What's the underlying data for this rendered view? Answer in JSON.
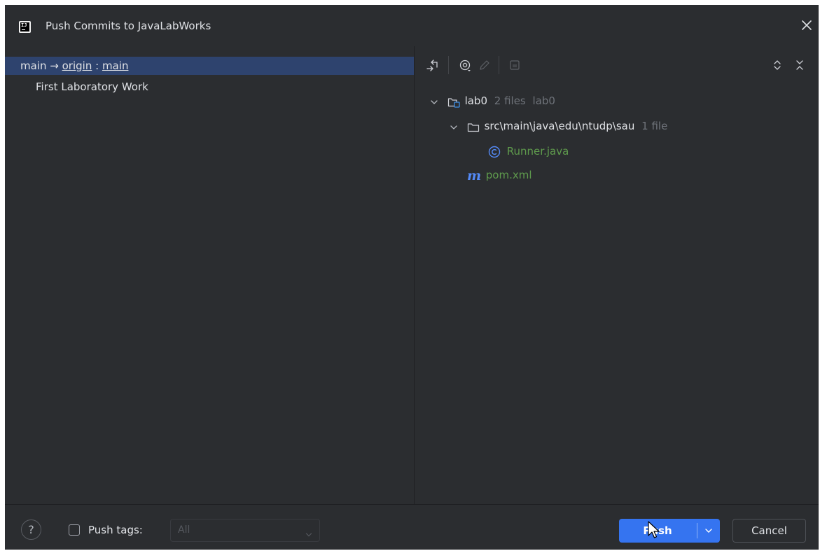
{
  "window": {
    "title": "Push Commits to JavaLabWorks",
    "logo_text": "IJ",
    "close_icon": "close-icon"
  },
  "left_pane": {
    "branch": {
      "local": "main",
      "arrow": "→",
      "remote": "origin",
      "separator": ":",
      "remote_branch": "main"
    },
    "commits": [
      "First Laboratory Work"
    ]
  },
  "right_pane": {
    "toolbar_icons": [
      "diff-arrows-icon",
      "eye-icon",
      "edit-pencil-icon",
      "shelf-icon",
      "expand-all-icon",
      "collapse-all-icon"
    ],
    "tree": {
      "module": {
        "name": "lab0",
        "count": "2 files",
        "extra": "lab0"
      },
      "folder": {
        "name": "src\\main\\java\\edu\\ntudp\\sau",
        "count": "1 file"
      },
      "files": [
        {
          "name": "Runner.java",
          "icon": "class-icon"
        },
        {
          "name": "pom.xml",
          "icon": "maven-icon"
        }
      ]
    }
  },
  "bottom": {
    "help_label": "?",
    "push_tags_label": "Push tags:",
    "push_tags_checked": false,
    "tags_select_value": "All",
    "push_label": "Push",
    "cancel_label": "Cancel"
  },
  "colors": {
    "background": "#2b2d30",
    "selection": "#2e436e",
    "accent": "#3574f0",
    "file_added": "#5f9b4d",
    "muted": "#6f737a"
  }
}
